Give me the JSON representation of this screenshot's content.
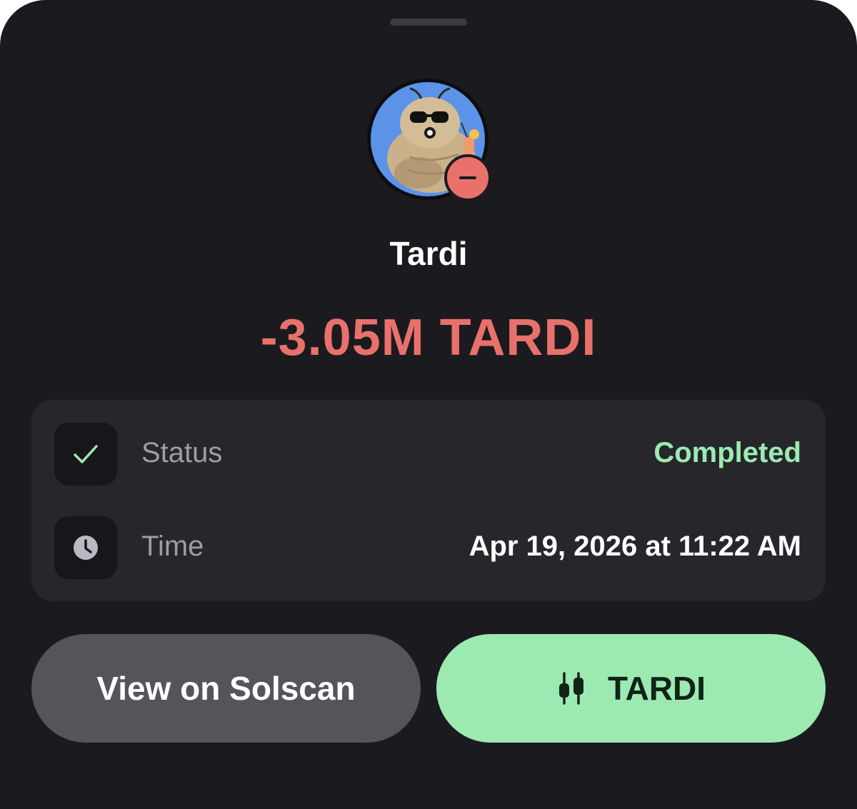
{
  "token": {
    "name": "Tardi",
    "amount": "-3.05M TARDI",
    "avatar_icon": "tardigrade-avatar",
    "badge_icon": "minus-icon"
  },
  "details": {
    "status": {
      "label": "Status",
      "value": "Completed",
      "icon": "check-icon"
    },
    "time": {
      "label": "Time",
      "value": "Apr 19, 2026 at 11:22 AM",
      "icon": "clock-icon"
    }
  },
  "actions": {
    "solscan_label": "View on Solscan",
    "token_label": "TARDI",
    "token_icon": "candlestick-chart-icon"
  },
  "colors": {
    "background": "#1b1b1f",
    "card": "#26262b",
    "negative": "#e8716c",
    "positive": "#9ceab2",
    "secondary_button": "#545459"
  }
}
